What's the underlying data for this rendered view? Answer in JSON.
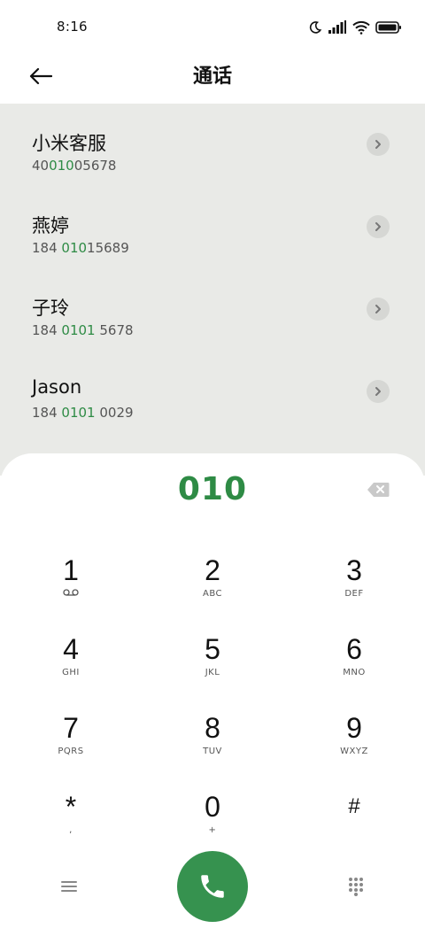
{
  "status_bar": {
    "time": "8:16"
  },
  "header": {
    "title": "通话"
  },
  "contacts": [
    {
      "name": "小米客服",
      "number_pre": "40",
      "number_match": "010",
      "number_post": "05678"
    },
    {
      "name": "燕婷",
      "number_pre": "184 ",
      "number_match": "010",
      "number_post": "15689"
    },
    {
      "name": "子玲",
      "number_pre": "184 ",
      "number_match": "0101",
      "number_post": " 5678"
    },
    {
      "name": "Jason",
      "number_pre": "184 ",
      "number_match": "0101",
      "number_post": " 0029"
    }
  ],
  "dialer": {
    "number": "010",
    "keys": [
      {
        "digit": "1",
        "letters": ""
      },
      {
        "digit": "2",
        "letters": "ABC"
      },
      {
        "digit": "3",
        "letters": "DEF"
      },
      {
        "digit": "4",
        "letters": "GHI"
      },
      {
        "digit": "5",
        "letters": "JKL"
      },
      {
        "digit": "6",
        "letters": "MNO"
      },
      {
        "digit": "7",
        "letters": "PQRS"
      },
      {
        "digit": "8",
        "letters": "TUV"
      },
      {
        "digit": "9",
        "letters": "WXYZ"
      },
      {
        "digit": "*",
        "letters": ","
      },
      {
        "digit": "0",
        "letters": "+"
      },
      {
        "digit": "#",
        "letters": ""
      }
    ]
  },
  "colors": {
    "accent_green": "#2e8b45",
    "call_button": "#36924f",
    "suggestions_bg": "#e9eae7"
  },
  "icons": {
    "back": "arrow-left-icon",
    "voicemail": "voicemail-icon",
    "backspace": "backspace-icon",
    "menu": "menu-icon",
    "call": "phone-icon",
    "keypad": "dialpad-icon"
  }
}
